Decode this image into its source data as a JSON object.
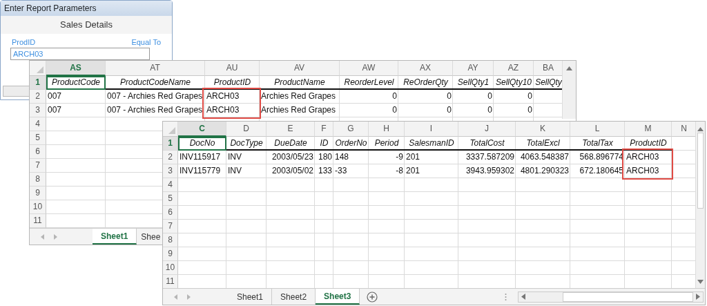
{
  "dialog": {
    "title": "Enter Report Parameters",
    "heading": "Sales Details",
    "field_label": "ProdID",
    "operator": "Equal To",
    "value": "ARCH03"
  },
  "sheets": [
    {
      "columns": [
        {
          "letter": "AS",
          "header": "ProductCode",
          "selected": true,
          "numeric": false
        },
        {
          "letter": "AT",
          "header": "ProductCodeName",
          "selected": false,
          "numeric": false
        },
        {
          "letter": "AU",
          "header": "ProductID",
          "selected": false,
          "numeric": false,
          "highlighted": true
        },
        {
          "letter": "AV",
          "header": "ProductName",
          "selected": false,
          "numeric": false
        },
        {
          "letter": "AW",
          "header": "ReorderLevel",
          "selected": false,
          "numeric": true
        },
        {
          "letter": "AX",
          "header": "ReOrderQty",
          "selected": false,
          "numeric": true
        },
        {
          "letter": "AY",
          "header": "SellQty1",
          "selected": false,
          "numeric": true
        },
        {
          "letter": "AZ",
          "header": "SellQty10",
          "selected": false,
          "numeric": true
        },
        {
          "letter": "BA",
          "header": "SellQty",
          "selected": false
        }
      ],
      "row_numbers": [
        {
          "label": "1",
          "selected": true
        },
        {
          "label": "2",
          "selected": false
        },
        {
          "label": "3",
          "selected": false
        },
        {
          "label": "4",
          "selected": false
        },
        {
          "label": "5",
          "selected": false
        },
        {
          "label": "6",
          "selected": false
        },
        {
          "label": "7",
          "selected": false
        },
        {
          "label": "8",
          "selected": false
        },
        {
          "label": "9",
          "selected": false
        },
        {
          "label": "10",
          "selected": false
        },
        {
          "label": "11",
          "selected": false
        }
      ],
      "rows": [
        [
          "007",
          "007 - Archies Red Grapes",
          "ARCH03",
          "Archies Red Grapes",
          "0",
          "0",
          "0",
          "0"
        ],
        [
          "007",
          "007 - Archies Red Grapes",
          "ARCH03",
          "Archies Red Grapes",
          "0",
          "0",
          "0",
          "0"
        ]
      ],
      "tabs": [
        {
          "label": "Sheet1",
          "selected": true
        },
        {
          "label": "Shee",
          "selected": false
        }
      ]
    },
    {
      "columns": [
        {
          "letter": "C",
          "header": "DocNo",
          "selected": true,
          "numeric": false
        },
        {
          "letter": "D",
          "header": "DocType",
          "selected": false,
          "numeric": false
        },
        {
          "letter": "E",
          "header": "DueDate",
          "selected": false,
          "numeric": true
        },
        {
          "letter": "F",
          "header": "ID",
          "selected": false,
          "numeric": true
        },
        {
          "letter": "G",
          "header": "OrderNo",
          "selected": false,
          "numeric": false
        },
        {
          "letter": "H",
          "header": "Period",
          "selected": false,
          "numeric": true
        },
        {
          "letter": "I",
          "header": "SalesmanID",
          "selected": false,
          "numeric": false
        },
        {
          "letter": "J",
          "header": "TotalCost",
          "selected": false,
          "numeric": true
        },
        {
          "letter": "K",
          "header": "TotalExcl",
          "selected": false,
          "numeric": true
        },
        {
          "letter": "L",
          "header": "TotalTax",
          "selected": false,
          "numeric": true
        },
        {
          "letter": "M",
          "header": "ProductID",
          "selected": false,
          "numeric": false,
          "highlighted": true
        },
        {
          "letter": "N",
          "selected": false
        }
      ],
      "row_numbers": [
        {
          "label": "1",
          "selected": true
        },
        {
          "label": "2",
          "selected": false
        },
        {
          "label": "3",
          "selected": false
        },
        {
          "label": "4",
          "selected": false
        },
        {
          "label": "5",
          "selected": false
        },
        {
          "label": "6",
          "selected": false
        },
        {
          "label": "7",
          "selected": false
        },
        {
          "label": "8",
          "selected": false
        },
        {
          "label": "9",
          "selected": false
        },
        {
          "label": "10",
          "selected": false
        },
        {
          "label": "11",
          "selected": false
        }
      ],
      "rows": [
        [
          "INV115917",
          "INV",
          "2003/05/23",
          "180",
          "148",
          "-9",
          "201",
          "3337.587209",
          "4063.548387",
          "568.896774",
          "ARCH03"
        ],
        [
          "INV115779",
          "INV",
          "2003/05/02",
          "133",
          "-33",
          "-8",
          "201",
          "3943.959302",
          "4801.290323",
          "672.180645",
          "ARCH03"
        ]
      ],
      "tabs": [
        {
          "label": "Sheet1",
          "selected": false
        },
        {
          "label": "Sheet2",
          "selected": false
        },
        {
          "label": "Sheet3",
          "selected": true
        }
      ]
    }
  ]
}
